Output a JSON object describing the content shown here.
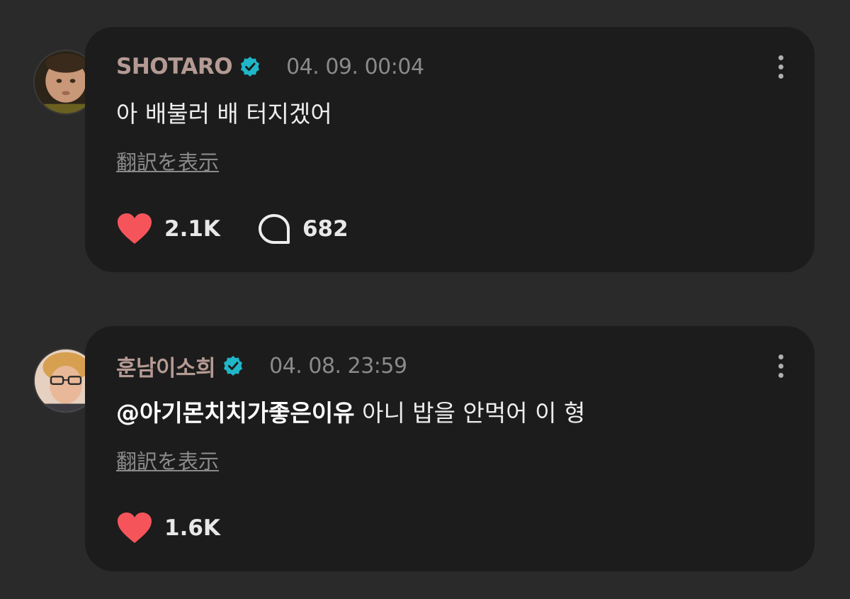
{
  "colors": {
    "background": "#2a2a2a",
    "card": "#1c1c1c",
    "username": "#b59a94",
    "verified": "#1fb6c8",
    "heart": "#f5555a"
  },
  "posts": [
    {
      "username": "SHOTARO",
      "verified": true,
      "timestamp": "04. 09. 00:04",
      "mention": "",
      "text": "아 배불러 배 터지겠어",
      "translate_label": "翻訳を表示",
      "likes": "2.1K",
      "comments": "682",
      "icons": [
        "heart-icon",
        "comment-icon",
        "more-icon",
        "verified-icon"
      ]
    },
    {
      "username": "훈남이소희",
      "verified": true,
      "timestamp": "04. 08. 23:59",
      "mention": "@아기몬치치가좋은이유",
      "text": " 아니 밥을 안먹어 이 형",
      "translate_label": "翻訳を表示",
      "likes": "1.6K",
      "icons": [
        "heart-icon",
        "more-icon",
        "verified-icon"
      ]
    }
  ]
}
